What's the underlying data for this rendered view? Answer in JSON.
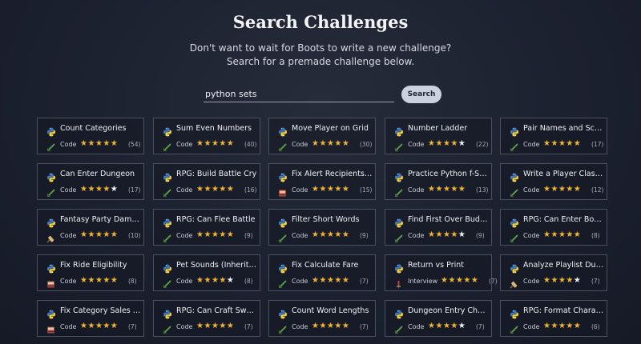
{
  "header": {
    "title": "Search Challenges",
    "subtitle_line1": "Don't want to wait for Boots to write a new challenge?",
    "subtitle_line2": "Search for a premade challenge below."
  },
  "search": {
    "value": "python sets",
    "button_label": "Search"
  },
  "colors": {
    "star_on": "#f1b530",
    "star_off": "#f3f3f3",
    "card_border": "#4a5060",
    "button_bg": "#c9d2dd"
  },
  "cards": [
    {
      "title": "Count Categories",
      "type": "Code",
      "type_icon": "sword-icon",
      "stars": 5,
      "count": "(54)"
    },
    {
      "title": "Sum Even Numbers",
      "type": "Code",
      "type_icon": "sword-icon",
      "stars": 5,
      "count": "(40)"
    },
    {
      "title": "Move Player on Grid",
      "type": "Code",
      "type_icon": "sword-icon",
      "stars": 5,
      "count": "(30)"
    },
    {
      "title": "Number Ladder",
      "type": "Code",
      "type_icon": "sword-icon",
      "stars": 4,
      "count": "(22)"
    },
    {
      "title": "Pair Names and Scores",
      "type": "Code",
      "type_icon": "sword-icon",
      "stars": 5,
      "count": "(17)"
    },
    {
      "title": "Can Enter Dungeon",
      "type": "Code",
      "type_icon": "sword-icon",
      "stars": 4,
      "count": "(17)"
    },
    {
      "title": "RPG: Build Battle Cry",
      "type": "Code",
      "type_icon": "sword-icon",
      "stars": 5,
      "count": "(16)"
    },
    {
      "title": "Fix Alert Recipients (S...",
      "type": "Code",
      "type_icon": "book-icon",
      "stars": 5,
      "count": "(15)"
    },
    {
      "title": "Practice Python f-Stri...",
      "type": "Code",
      "type_icon": "sword-icon",
      "stars": 5,
      "count": "(13)"
    },
    {
      "title": "Write a Player Class (...",
      "type": "Code",
      "type_icon": "sword-icon",
      "stars": 5,
      "count": "(12)"
    },
    {
      "title": "Fantasy Party Damage...",
      "type": "Code",
      "type_icon": "scroll-icon",
      "stars": 5,
      "count": "(10)"
    },
    {
      "title": "RPG: Can Flee Battle",
      "type": "Code",
      "type_icon": "sword-icon",
      "stars": 5,
      "count": "(9)"
    },
    {
      "title": "Filter Short Words",
      "type": "Code",
      "type_icon": "sword-icon",
      "stars": 5,
      "count": "(9)"
    },
    {
      "title": "Find First Over Budget",
      "type": "Code",
      "type_icon": "sword-icon",
      "stars": 4,
      "count": "(9)"
    },
    {
      "title": "RPG: Can Enter Boss ...",
      "type": "Code",
      "type_icon": "sword-icon",
      "stars": 5,
      "count": "(8)"
    },
    {
      "title": "Fix Ride Eligibility",
      "type": "Code",
      "type_icon": "book-icon",
      "stars": 5,
      "count": "(8)"
    },
    {
      "title": "Pet Sounds (Inheritan...",
      "type": "Code",
      "type_icon": "sword-icon",
      "stars": 4,
      "count": "(8)"
    },
    {
      "title": "Fix Calculate Fare",
      "type": "Code",
      "type_icon": "sword-icon",
      "stars": 5,
      "count": "(7)"
    },
    {
      "title": "Return vs Print",
      "type": "Interview",
      "type_icon": "dagger-icon",
      "stars": 5,
      "count": "(7)"
    },
    {
      "title": "Analyze Playlist Durat...",
      "type": "Code",
      "type_icon": "scroll-icon",
      "stars": 4,
      "count": "(7)"
    },
    {
      "title": "Fix Category Sales Ag...",
      "type": "Code",
      "type_icon": "book-icon",
      "stars": 5,
      "count": "(7)"
    },
    {
      "title": "RPG: Can Craft Sword",
      "type": "Code",
      "type_icon": "sword-icon",
      "stars": 5,
      "count": "(7)"
    },
    {
      "title": "Count Word Lengths",
      "type": "Code",
      "type_icon": "sword-icon",
      "stars": 5,
      "count": "(7)"
    },
    {
      "title": "Dungeon Entry Check",
      "type": "Code",
      "type_icon": "sword-icon",
      "stars": 4,
      "count": "(7)"
    },
    {
      "title": "RPG: Format Characte...",
      "type": "Code",
      "type_icon": "sword-icon",
      "stars": 5,
      "count": "(6)"
    }
  ]
}
